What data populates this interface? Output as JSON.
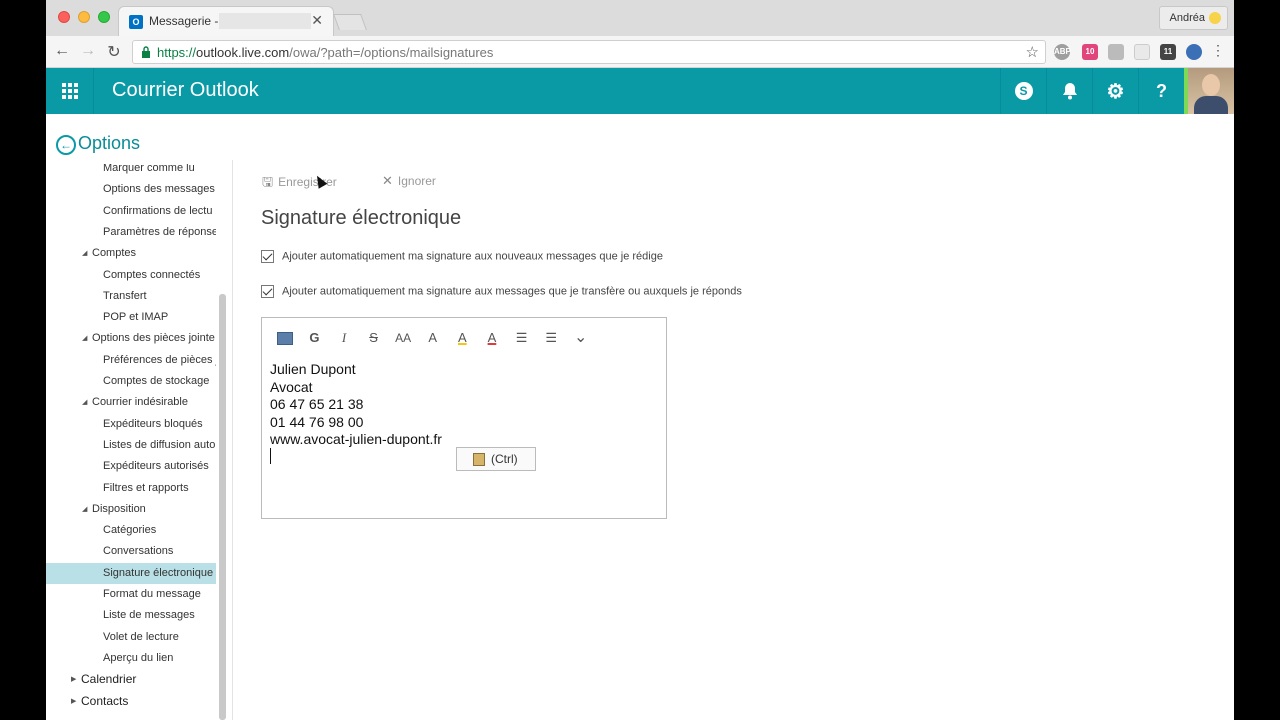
{
  "browser": {
    "tab_title": "Messagerie -",
    "tab_close": "✕",
    "profile_name": "Andréa",
    "url_secure": "https://",
    "url_host": "outlook.live.com",
    "url_path": "/owa/?path=/options/mailsignatures",
    "ext_badges": [
      "ABP",
      "10",
      "11"
    ]
  },
  "header": {
    "app_title": "Courrier Outlook"
  },
  "options": {
    "title": "Options"
  },
  "sidebar": {
    "items": [
      {
        "label": "Marquer comme lu",
        "level": "sub"
      },
      {
        "label": "Options des messages",
        "level": "sub"
      },
      {
        "label": "Confirmations de lectu",
        "level": "sub"
      },
      {
        "label": "Paramètres de réponse",
        "level": "sub"
      },
      {
        "label": "Comptes",
        "level": "group"
      },
      {
        "label": "Comptes connectés",
        "level": "sub"
      },
      {
        "label": "Transfert",
        "level": "sub"
      },
      {
        "label": "POP et IMAP",
        "level": "sub"
      },
      {
        "label": "Options des pièces jointe",
        "level": "group"
      },
      {
        "label": "Préférences de pièces j",
        "level": "sub"
      },
      {
        "label": "Comptes de stockage",
        "level": "sub"
      },
      {
        "label": "Courrier indésirable",
        "level": "group"
      },
      {
        "label": "Expéditeurs bloqués",
        "level": "sub"
      },
      {
        "label": "Listes de diffusion auto",
        "level": "sub"
      },
      {
        "label": "Expéditeurs autorisés",
        "level": "sub"
      },
      {
        "label": "Filtres et rapports",
        "level": "sub"
      },
      {
        "label": "Disposition",
        "level": "group"
      },
      {
        "label": "Catégories",
        "level": "sub"
      },
      {
        "label": "Conversations",
        "level": "sub"
      },
      {
        "label": "Signature électronique",
        "level": "sub",
        "selected": true
      },
      {
        "label": "Format du message",
        "level": "sub"
      },
      {
        "label": "Liste de messages",
        "level": "sub"
      },
      {
        "label": "Volet de lecture",
        "level": "sub"
      },
      {
        "label": "Aperçu du lien",
        "level": "sub"
      },
      {
        "label": "Calendrier",
        "level": "top"
      },
      {
        "label": "Contacts",
        "level": "top"
      }
    ]
  },
  "commands": {
    "save_label": "Enregistrer",
    "ignore_label": "Ignorer"
  },
  "main": {
    "heading": "Signature électronique",
    "checkbox1_label": "Ajouter automatiquement ma signature aux nouveaux messages que je rédige",
    "checkbox2_label": "Ajouter automatiquement ma signature aux messages que je transfère ou auxquels je réponds"
  },
  "editor": {
    "toolbar": {
      "bold": "G",
      "italic": "I",
      "strike": "S",
      "font_size": "AA",
      "grow": "A",
      "highlight": "A",
      "font_color": "A",
      "bullets": "☰",
      "numbering": "☰",
      "more": "⌄"
    },
    "signature_lines": [
      "Julien Dupont",
      "Avocat",
      "06 47 65 21 38",
      "01 44 76 98 00",
      "www.avocat-julien-dupont.fr"
    ],
    "paste_label": "(Ctrl)"
  },
  "colors": {
    "accent": "#0a9aa6",
    "selected": "#b8e0e6"
  }
}
